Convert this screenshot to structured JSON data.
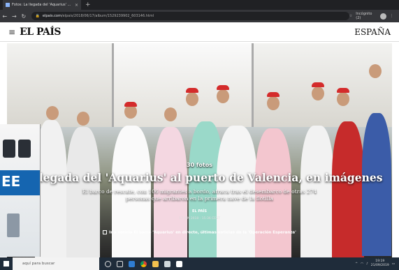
{
  "browser": {
    "tab_title": "Fotos: La llegada del 'Aquarius' ...",
    "tab_close": "×",
    "new_tab": "+",
    "url_host": "elpais.com",
    "url_path": "/elpais/2018/06/17/album/1529239902_603146.html",
    "profile_label": "Incógnito (2)"
  },
  "site": {
    "menu_glyph": "≡",
    "logo": "EL PAÍS",
    "edition": "ESPAÑA"
  },
  "gallery": {
    "photo_count": "30 fotos",
    "headline": "La llegada del 'Aquarius' al puerto de Valencia, en imágenes",
    "subhead": "El barco de rescate, con 106 migrantes a bordo, atraca tras el desembarco de otras 274 personas que arribaron en la primera nave de la flotilla",
    "byline": "EL PAÍS",
    "date": "17 JUN 2018 - 15:36 CEST",
    "related_link": "Ir a noticia El barco 'Aquarius' en directo, últimas noticias de la 'Operación Esperanza'"
  },
  "other_window": {
    "hull_text": "EE"
  },
  "taskbar": {
    "search_placeholder": "aquí para buscar",
    "time": "19:19",
    "date": "21/09/2019"
  },
  "icons": [
    "back-icon",
    "forward-icon",
    "reload-icon",
    "lock-icon",
    "star-icon",
    "incognito-icon",
    "menu-icon",
    "windows-start-icon",
    "taskview-icon",
    "edge-icon",
    "chrome-icon",
    "folder-icon",
    "store-icon",
    "mail-icon",
    "wifi-icon",
    "volume-icon"
  ],
  "colors": {
    "chrome_dark": "#202124",
    "taskbar": "#1f2c3a",
    "red_cross": "#d42b2b",
    "hull_blue": "#1565b0"
  }
}
